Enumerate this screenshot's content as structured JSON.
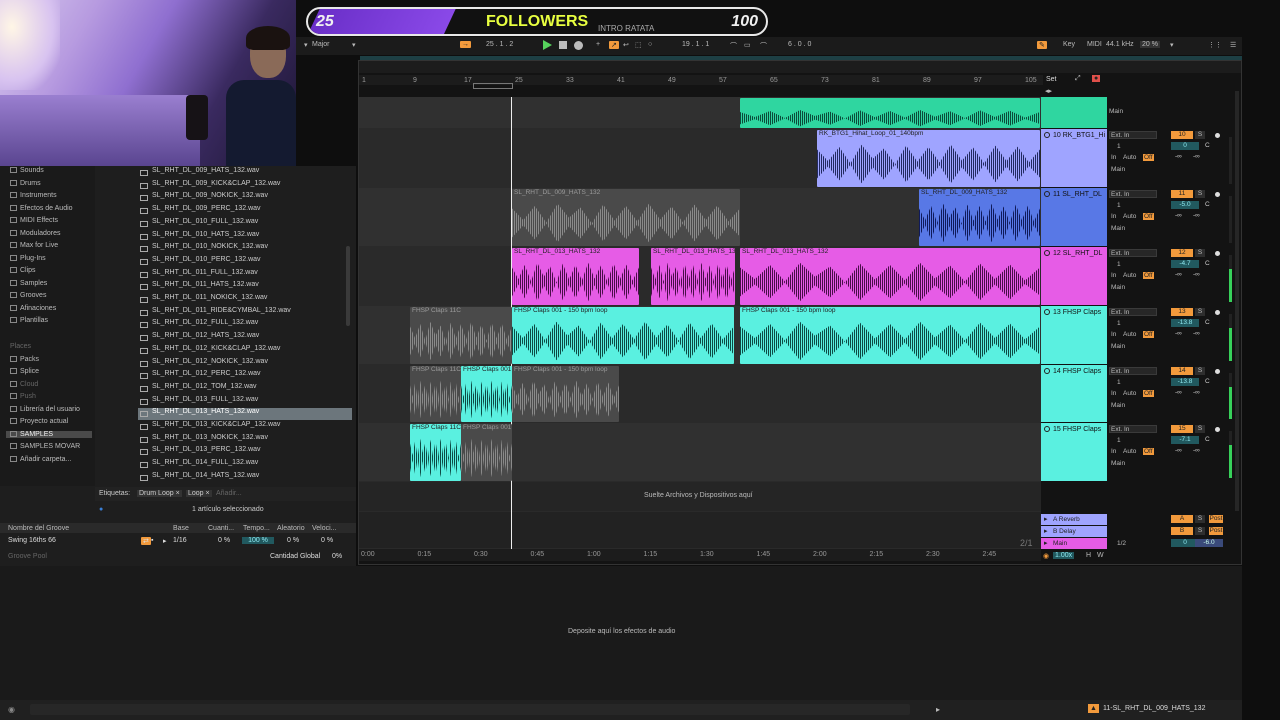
{
  "overlay": {
    "followers_current": "25",
    "followers_title": "FOLLOWERS",
    "followers_sub": "INTRO RATATA",
    "followers_goal": "100",
    "progress_fraction": 0.25
  },
  "toolbar": {
    "scale": "Major",
    "position": "25 .  1 .  2",
    "loop_start": "19 .  1 .  1",
    "loop_length": "6 .  0 .  0",
    "key_label": "Key",
    "midi_label": "MIDI",
    "sample_rate": "44.1 kHz",
    "cpu": "20 %"
  },
  "browser": {
    "categories": [
      "Sounds",
      "Drums",
      "Instruments",
      "Efectos de Audio",
      "MIDI Effects",
      "Moduladores",
      "Max for Live",
      "Plug-Ins",
      "Clips",
      "Samples",
      "Grooves",
      "Afinaciones",
      "Plantillas"
    ],
    "places_label": "Places",
    "places": [
      "Packs",
      "Splice",
      "Cloud",
      "Push",
      "Librería del usuario",
      "Proyecto actual",
      "SAMPLES",
      "SAMPLES MOVAR",
      "Añadir carpeta..."
    ],
    "files": [
      "SL_RHT_DL_009_HATS_132.wav",
      "SL_RHT_DL_009_KICK&CLAP_132.wav",
      "SL_RHT_DL_009_NOKICK_132.wav",
      "SL_RHT_DL_009_PERC_132.wav",
      "SL_RHT_DL_010_FULL_132.wav",
      "SL_RHT_DL_010_HATS_132.wav",
      "SL_RHT_DL_010_NOKICK_132.wav",
      "SL_RHT_DL_010_PERC_132.wav",
      "SL_RHT_DL_011_FULL_132.wav",
      "SL_RHT_DL_011_HATS_132.wav",
      "SL_RHT_DL_011_NOKICK_132.wav",
      "SL_RHT_DL_011_RIDE&CYMBAL_132.wav",
      "SL_RHT_DL_012_FULL_132.wav",
      "SL_RHT_DL_012_HATS_132.wav",
      "SL_RHT_DL_012_KICK&CLAP_132.wav",
      "SL_RHT_DL_012_NOKICK_132.wav",
      "SL_RHT_DL_012_PERC_132.wav",
      "SL_RHT_DL_012_TOM_132.wav",
      "SL_RHT_DL_013_FULL_132.wav",
      "SL_RHT_DL_013_HATS_132.wav",
      "SL_RHT_DL_013_KICK&CLAP_132.wav",
      "SL_RHT_DL_013_NOKICK_132.wav",
      "SL_RHT_DL_013_PERC_132.wav",
      "SL_RHT_DL_014_FULL_132.wav",
      "SL_RHT_DL_014_HATS_132.wav"
    ],
    "selected_file_index": 19,
    "tags_label": "Etiquetas:",
    "tags": [
      "Drum Loop",
      "Loop"
    ],
    "tag_add": "Añadir...",
    "selection_info": "1 artículo seleccionado"
  },
  "groove": {
    "headers": [
      "Nombre del Groove",
      "Base",
      "Cuanti...",
      "Tempo...",
      "Aleatorio",
      "Veloci..."
    ],
    "row": {
      "name": "Swing 16ths 66",
      "base": "1/16",
      "quant": "0 %",
      "timing": "100 %",
      "random": "0 %",
      "velocity": "0 %"
    },
    "pool_label": "Groove Pool",
    "global_label": "Cantidad Global",
    "global_value": "0%"
  },
  "arrangement": {
    "bars": [
      "1",
      "9",
      "17",
      "25",
      "33",
      "41",
      "49",
      "57",
      "65",
      "73",
      "81",
      "89",
      "97",
      "105"
    ],
    "times": [
      "0:00",
      "0:15",
      "0:30",
      "0:45",
      "1:00",
      "1:15",
      "1:30",
      "1:45",
      "2:00",
      "2:15",
      "2:30",
      "2:45"
    ],
    "set_label": "Set",
    "drop_hint": "Suelte Archivos y Dispositivos aquí",
    "tracks": [
      {
        "name": "",
        "number": "",
        "color": "#2fd6a0"
      },
      {
        "name": "10 RK_BTG1_Hi",
        "number": "10",
        "color": "#9fa4ff"
      },
      {
        "name": "11 SL_RHT_DL",
        "number": "11",
        "color": "#5878e6"
      },
      {
        "name": "12 SL_RHT_DL",
        "number": "12",
        "color": "#e65ce6"
      },
      {
        "name": "13 FHSP Claps",
        "number": "13",
        "color": "#5af0e0"
      },
      {
        "name": "14 FHSP Claps",
        "number": "14",
        "color": "#5af0e0"
      },
      {
        "name": "15 FHSP Claps",
        "number": "15",
        "color": "#5af0e0"
      }
    ],
    "clips": {
      "t10": "RK_BTG1_Hihat_Loop_01_140bpm",
      "t11a": "SL_RHT_DL_009_HATS_132",
      "t11b": "SL_RHT_DL_009_HATS_132",
      "t12a": "SL_RHT_DL_013_HATS_132",
      "t12b": "SL_RHT_DL_013_HATS_132",
      "t12c": "SL_RHT_DL_013_HATS_132",
      "t13a": "FHSP Claps 11C",
      "t13b": "FHSP Claps 001 - 150 bpm loop",
      "t13c": "FHSP Claps 001 - 150 bpm loop",
      "t14a": "FHSP Claps 11C",
      "t14b": "FHSP Claps 001",
      "t14c": "FHSP Claps 001 - 150 bpm loop",
      "t15a": "FHSP Claps 11C",
      "t15b": "FHSP Claps 001"
    },
    "io": {
      "input": "Ext. In",
      "channel": "1",
      "monitor": [
        "In",
        "Auto",
        "Off"
      ],
      "output": "Main"
    },
    "mixer": {
      "vol": [
        "0",
        "-5.0",
        "-4.7",
        "-13.8",
        "-13.8",
        "-7.1"
      ],
      "pan": "C",
      "send": "-∞"
    },
    "returns": [
      {
        "name": "A Reverb",
        "letter": "A"
      },
      {
        "name": "B Delay",
        "letter": "B"
      },
      {
        "name": "Main",
        "letter": ""
      }
    ],
    "post": "Post",
    "main_ratio": "1/2",
    "main_vol": "0",
    "main_db": "-6.0",
    "page": "2/1",
    "zoom": "1.00x"
  },
  "devices": {
    "hint": "Deposite aquí los efectos de audio"
  },
  "status": {
    "selected_clip": "11-SL_RHT_DL_009_HATS_132"
  }
}
